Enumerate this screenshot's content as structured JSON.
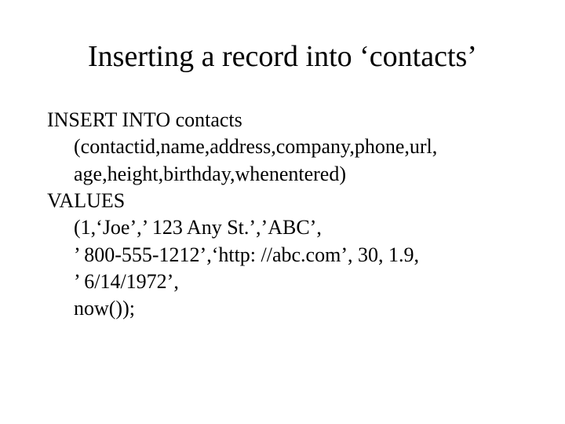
{
  "title": "Inserting a record into ‘contacts’",
  "code": {
    "line1": "INSERT INTO contacts",
    "line2": "(contactid,name,address,company,phone,url,",
    "line3": "age,height,birthday,whenentered)",
    "line4": "VALUES",
    "line5": "(1,‘Joe’,’ 123 Any St.’,’ABC’,",
    "line6": "’ 800-555-1212’,‘http: //abc.com’, 30, 1.9,",
    "line7": "’ 6/14/1972’,",
    "line8": "now());"
  }
}
